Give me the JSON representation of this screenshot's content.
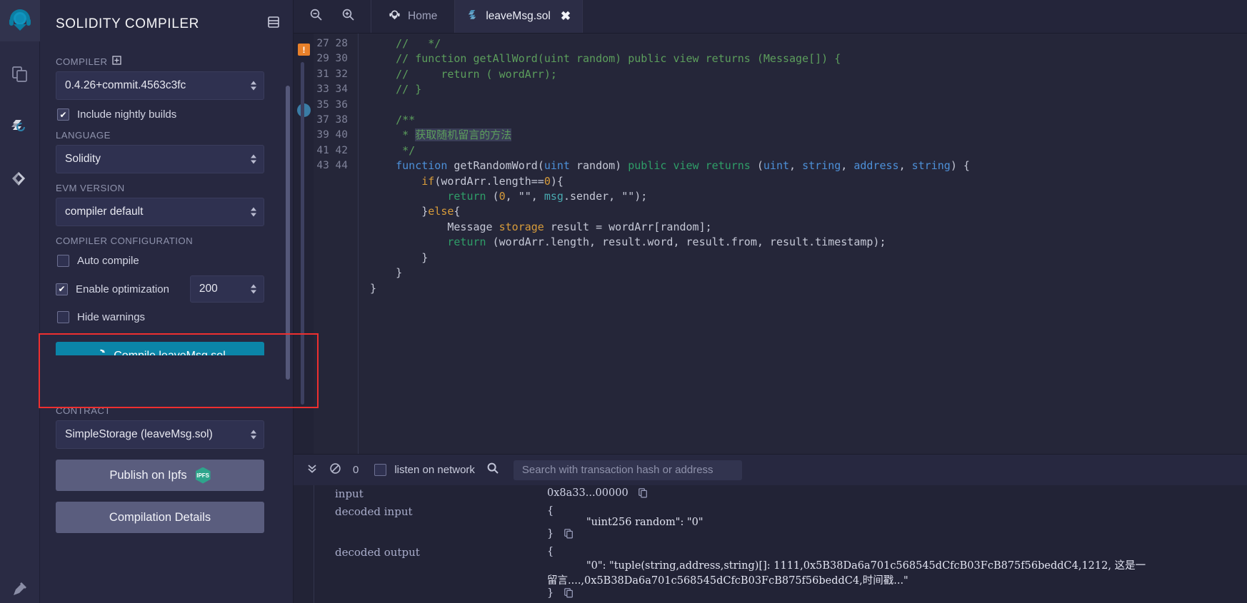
{
  "rail": {
    "logo_name": "remix-logo",
    "items": [
      {
        "name": "file-explorer-icon",
        "label": "File explorers"
      },
      {
        "name": "solidity-compiler-icon",
        "label": "Solidity compiler"
      },
      {
        "name": "deploy-run-icon",
        "label": "Deploy & run transactions"
      }
    ],
    "bottom": {
      "name": "plugin-manager-icon",
      "label": "Plugin manager"
    }
  },
  "panel": {
    "title": "SOLIDITY COMPILER",
    "layout_icon": "panel-layout-icon",
    "compiler": {
      "label": "COMPILER",
      "info_icon": "plus-box-icon",
      "value": "0.4.26+commit.4563c3fc"
    },
    "nightly": {
      "label": "Include nightly builds",
      "checked": true
    },
    "language": {
      "label": "LANGUAGE",
      "value": "Solidity"
    },
    "evm": {
      "label": "EVM VERSION",
      "value": "compiler default"
    },
    "configuration": {
      "label": "COMPILER CONFIGURATION",
      "auto_compile": {
        "label": "Auto compile",
        "checked": false
      },
      "enable_optimization": {
        "label": "Enable optimization",
        "checked": true,
        "runs": "200"
      },
      "hide_warnings": {
        "label": "Hide warnings",
        "checked": false
      }
    },
    "compile_button": {
      "label": "Compile leaveMsg.sol",
      "icon": "refresh-icon",
      "color": "#0b85a8"
    },
    "highlight_color": "#ee2f2f",
    "contract": {
      "label": "CONTRACT",
      "value": "SimpleStorage (leaveMsg.sol)"
    },
    "publish_button": {
      "label": "Publish on Ipfs",
      "badge": "IPFS"
    },
    "details_button": {
      "label": "Compilation Details"
    }
  },
  "tabbar": {
    "zoom_out_icon": "zoom-out-icon",
    "zoom_in_icon": "zoom-in-icon",
    "home": {
      "label": "Home",
      "icon": "remix-home-icon"
    },
    "tab": {
      "label": "leaveMsg.sol",
      "icon": "solidity-file-icon",
      "close_icon": "close-icon"
    }
  },
  "editor": {
    "error_marker": "!",
    "first_line_no": 27,
    "lines": [
      {
        "no": "27",
        "text": "    //   */"
      },
      {
        "no": "28",
        "text": "    // function getAllWord(uint random) public view returns (Message[]) {"
      },
      {
        "no": "29",
        "text": "    //     return ( wordArr);"
      },
      {
        "no": "30",
        "text": "    // }"
      },
      {
        "no": "31",
        "text": ""
      },
      {
        "no": "32",
        "text": "    /**"
      },
      {
        "no": "33",
        "text": "     * 获取随机留言的方法"
      },
      {
        "no": "34",
        "text": "     */"
      },
      {
        "no": "35",
        "text": "    function getRandomWord(uint random) public view returns (uint, string, address, string) {"
      },
      {
        "no": "36",
        "text": "        if(wordArr.length==0){"
      },
      {
        "no": "37",
        "text": "            return (0, \"\", msg.sender, \"\");"
      },
      {
        "no": "38",
        "text": "        }else{"
      },
      {
        "no": "39",
        "text": "            Message storage result = wordArr[random];"
      },
      {
        "no": "40",
        "text": "            return (wordArr.length, result.word, result.from, result.timestamp);"
      },
      {
        "no": "41",
        "text": "        }"
      },
      {
        "no": "42",
        "text": "    }"
      },
      {
        "no": "43",
        "text": "}"
      },
      {
        "no": "44",
        "text": ""
      }
    ]
  },
  "terminal": {
    "toggle_icon": "chevron-double-down-icon",
    "clear_icon": "ban-icon",
    "count": "0",
    "listen": {
      "label": "listen on network",
      "checked": false
    },
    "search_icon": "search-icon",
    "search_placeholder": "Search with transaction hash or address",
    "rows": [
      {
        "key": "input",
        "value": "0x8a33...00000",
        "copy_icon": "copy-icon"
      },
      {
        "key": "decoded input",
        "open": "{",
        "body": "\"uint256 random\": \"0\"",
        "close": "}",
        "copy_icon": "copy-icon"
      },
      {
        "key": "decoded output",
        "open": "{",
        "body_1": "\"0\": \"tuple(string,address,string)[]: 1111,0x5B38Da6a701c568545dCfcB03FcB875f56beddC4,1212, 这是一",
        "body_2": "留言....,0x5B38Da6a701c568545dCfcB03FcB875f56beddC4,时间戳...\"",
        "close": "}",
        "copy_icon": "copy-icon"
      }
    ]
  }
}
